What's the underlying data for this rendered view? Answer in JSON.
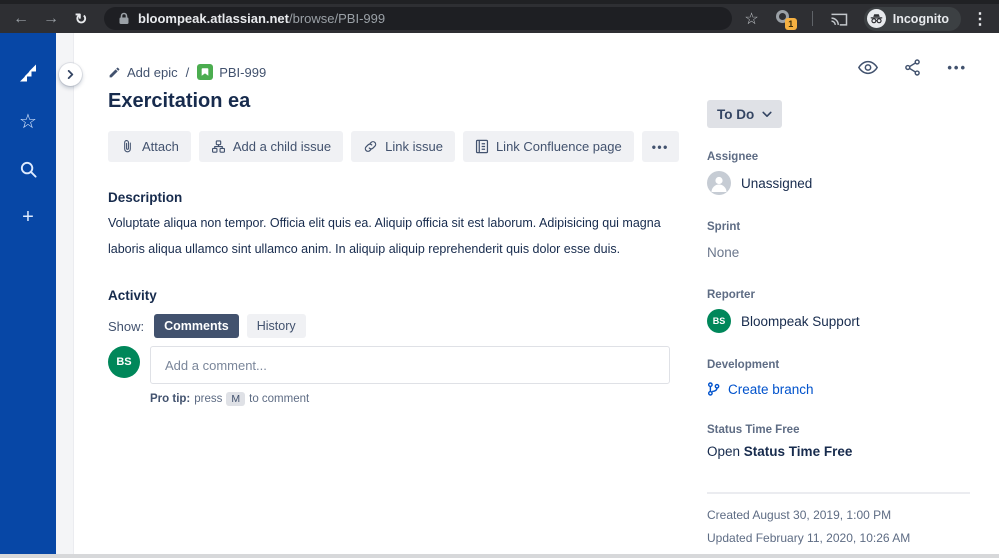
{
  "browser": {
    "url_host": "bloompeak.atlassian.net",
    "url_path": "/browse/PBI-999",
    "extension_badge": "1",
    "incognito_label": "Incognito"
  },
  "icons": {
    "back": "←",
    "forward": "→",
    "reload": "↻",
    "bookmark_star": "☆",
    "kebab": "⋮",
    "rail_star": "☆",
    "rail_plus": "+",
    "more_horizontal": "•••"
  },
  "breadcrumb": {
    "add_epic": "Add epic",
    "separator": "/",
    "issue_key": "PBI-999"
  },
  "issue": {
    "title": "Exercitation ea",
    "description_label": "Description",
    "description_text": "Voluptate aliqua non tempor. Officia elit quis ea. Aliquip officia sit est laborum. Adipisicing qui magna laboris aliqua ullamco sint ullamco anim. In aliquip aliquip reprehenderit quis dolor esse duis."
  },
  "toolbar": {
    "attach": "Attach",
    "add_child": "Add a child issue",
    "link_issue": "Link issue",
    "link_confluence": "Link Confluence page"
  },
  "activity": {
    "heading": "Activity",
    "show_label": "Show:",
    "tabs": [
      {
        "label": "Comments",
        "selected": true
      },
      {
        "label": "History",
        "selected": false
      }
    ],
    "avatar_initials": "BS",
    "comment_placeholder": "Add a comment...",
    "pro_tip": {
      "bold": "Pro tip:",
      "pre": "press",
      "key": "M",
      "post": "to comment"
    }
  },
  "panel": {
    "status_label": "To Do",
    "assignee_label": "Assignee",
    "assignee_value": "Unassigned",
    "sprint_label": "Sprint",
    "sprint_value": "None",
    "reporter_label": "Reporter",
    "reporter_initials": "BS",
    "reporter_value": "Bloompeak Support",
    "development_label": "Development",
    "create_branch_label": "Create branch",
    "custom_field": {
      "label": "Status Time Free",
      "value_prefix": "Open",
      "value_bold": "Status Time Free"
    },
    "created": "Created August 30, 2019, 1:00 PM",
    "updated": "Updated February 11, 2020, 10:26 AM"
  },
  "colors": {
    "rail_blue": "#0747a6",
    "link_blue": "#0052cc",
    "avatar_green": "#00875a",
    "story_green": "#4bad4f",
    "status_btn_bg": "#dfe1e6",
    "selected_tab_bg": "#42526e",
    "badge_orange": "#f5b041"
  }
}
